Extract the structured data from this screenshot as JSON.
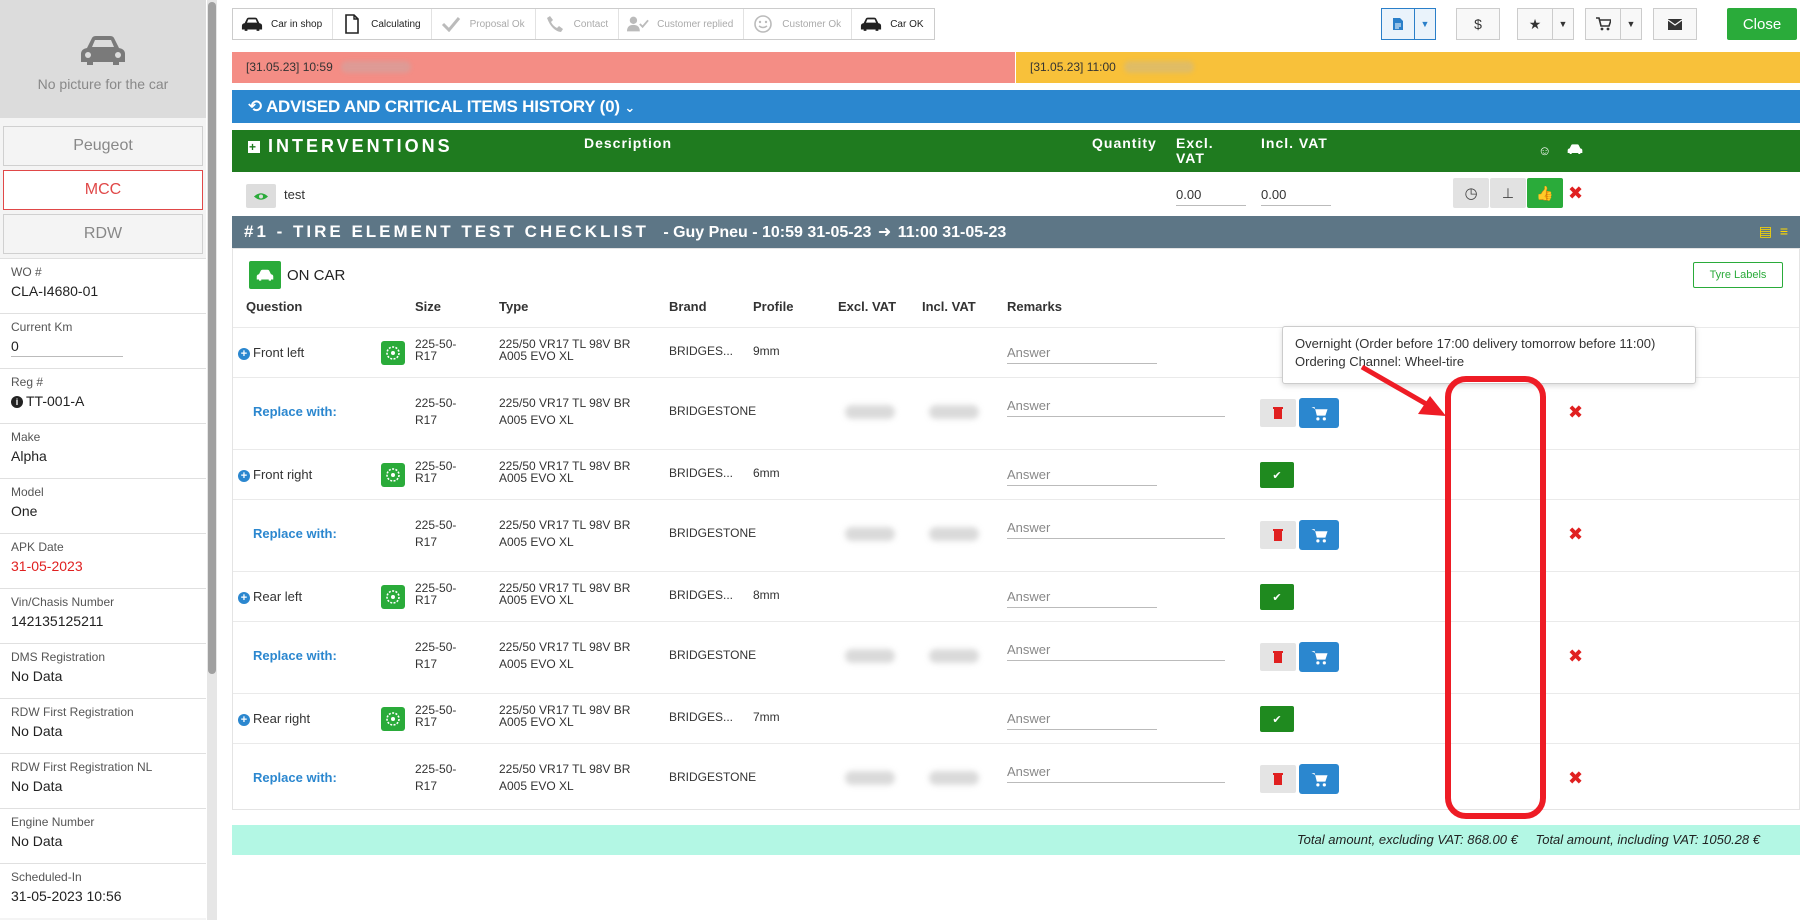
{
  "sidebar": {
    "no_picture": "No picture for the car",
    "buttons": [
      "Peugeot",
      "MCC",
      "RDW"
    ],
    "fields": [
      {
        "label": "WO #",
        "value": "CLA-I4680-01"
      },
      {
        "label": "Current Km",
        "value": "0"
      },
      {
        "label": "Reg #",
        "value": "TT-001-A"
      },
      {
        "label": "Make",
        "value": "Alpha"
      },
      {
        "label": "Model",
        "value": "One"
      },
      {
        "label": "APK Date",
        "value": "31-05-2023"
      },
      {
        "label": "Vin/Chasis Number",
        "value": "142135125211"
      },
      {
        "label": "DMS Registration",
        "value": "No Data"
      },
      {
        "label": "RDW First Registration",
        "value": "No Data"
      },
      {
        "label": "RDW First Registration NL",
        "value": "No Data"
      },
      {
        "label": "Engine Number",
        "value": "No Data"
      },
      {
        "label": "Scheduled-In",
        "value": "31-05-2023 10:56"
      }
    ]
  },
  "steps": [
    {
      "label": "Car in shop",
      "icon": "car-icon",
      "active": true
    },
    {
      "label": "Calculating",
      "icon": "document-icon",
      "active": true
    },
    {
      "label": "Proposal Ok",
      "icon": "check-icon",
      "active": false
    },
    {
      "label": "Contact",
      "icon": "phone-icon",
      "active": false
    },
    {
      "label": "Customer replied",
      "icon": "user-check-icon",
      "active": false
    },
    {
      "label": "Customer Ok",
      "icon": "smile-icon",
      "active": false
    },
    {
      "label": "Car OK",
      "icon": "car-icon",
      "active": true
    }
  ],
  "toolbar": {
    "dollar": "$",
    "close": "Close"
  },
  "timeline": {
    "seg1": "[31.05.23] 10:59",
    "seg2": "[31.05.23] 11:00"
  },
  "advised": {
    "title": "ADVISED AND CRITICAL ITEMS HISTORY (0)"
  },
  "interventions": {
    "title": "INTERVENTIONS",
    "col_description": "Description",
    "col_quantity": "Quantity",
    "col_excl_vat": "Excl. VAT",
    "col_incl_vat": "Incl. VAT",
    "row": {
      "name": "test",
      "excl": "0.00",
      "incl": "0.00"
    }
  },
  "checklist": {
    "title": "#1 - TIRE ELEMENT TEST CHECKLIST",
    "subtitle": "- Guy Pneu - 10:59 31-05-23",
    "subtitle_end": "11:00 31-05-23",
    "on_car": "ON CAR",
    "tyre_labels": "Tyre Labels",
    "columns": [
      "Question",
      "Size",
      "Type",
      "Brand",
      "Profile",
      "Excl. VAT",
      "Incl. VAT",
      "Remarks"
    ],
    "answer_placeholder": "Answer",
    "replace_label": "Replace with:",
    "rows": [
      {
        "question": "Front left",
        "size": "225-50-R17",
        "type": "225/50 VR17 TL 98V BR A005 EVO XL",
        "brand": "BRIDGES...",
        "profile": "9mm",
        "replace": {
          "size": "225-50-R17",
          "type": "225/50 VR17 TL 98V BR A005 EVO XL",
          "brand": "BRIDGESTONE"
        }
      },
      {
        "question": "Front right",
        "size": "225-50-R17",
        "type": "225/50 VR17 TL 98V BR A005 EVO XL",
        "brand": "BRIDGES...",
        "profile": "6mm",
        "replace": {
          "size": "225-50-R17",
          "type": "225/50 VR17 TL 98V BR A005 EVO XL",
          "brand": "BRIDGESTONE"
        }
      },
      {
        "question": "Rear left",
        "size": "225-50-R17",
        "type": "225/50 VR17 TL 98V BR A005 EVO XL",
        "brand": "BRIDGES...",
        "profile": "8mm",
        "replace": {
          "size": "225-50-R17",
          "type": "225/50 VR17 TL 98V BR A005 EVO XL",
          "brand": "BRIDGESTONE"
        }
      },
      {
        "question": "Rear right",
        "size": "225-50-R17",
        "type": "225/50 VR17 TL 98V BR A005 EVO XL",
        "brand": "BRIDGES...",
        "profile": "7mm",
        "replace": {
          "size": "225-50-R17",
          "type": "225/50 VR17 TL 98V BR A005 EVO XL",
          "brand": "BRIDGESTONE"
        }
      }
    ]
  },
  "tooltip": {
    "line1": "Overnight (Order before 17:00 delivery tomorrow before 11:00)",
    "line2": "Ordering Channel: Wheel-tire"
  },
  "totals": {
    "excl": "Total amount, excluding VAT: 868.00 €",
    "incl": "Total amount, including VAT: 1050.28 €"
  },
  "colors": {
    "accent_blue": "#2b87cf",
    "green": "#2aab3a",
    "dark_green": "#1f7b1f",
    "red": "#e02020",
    "annotation_red": "#ee1c25"
  }
}
